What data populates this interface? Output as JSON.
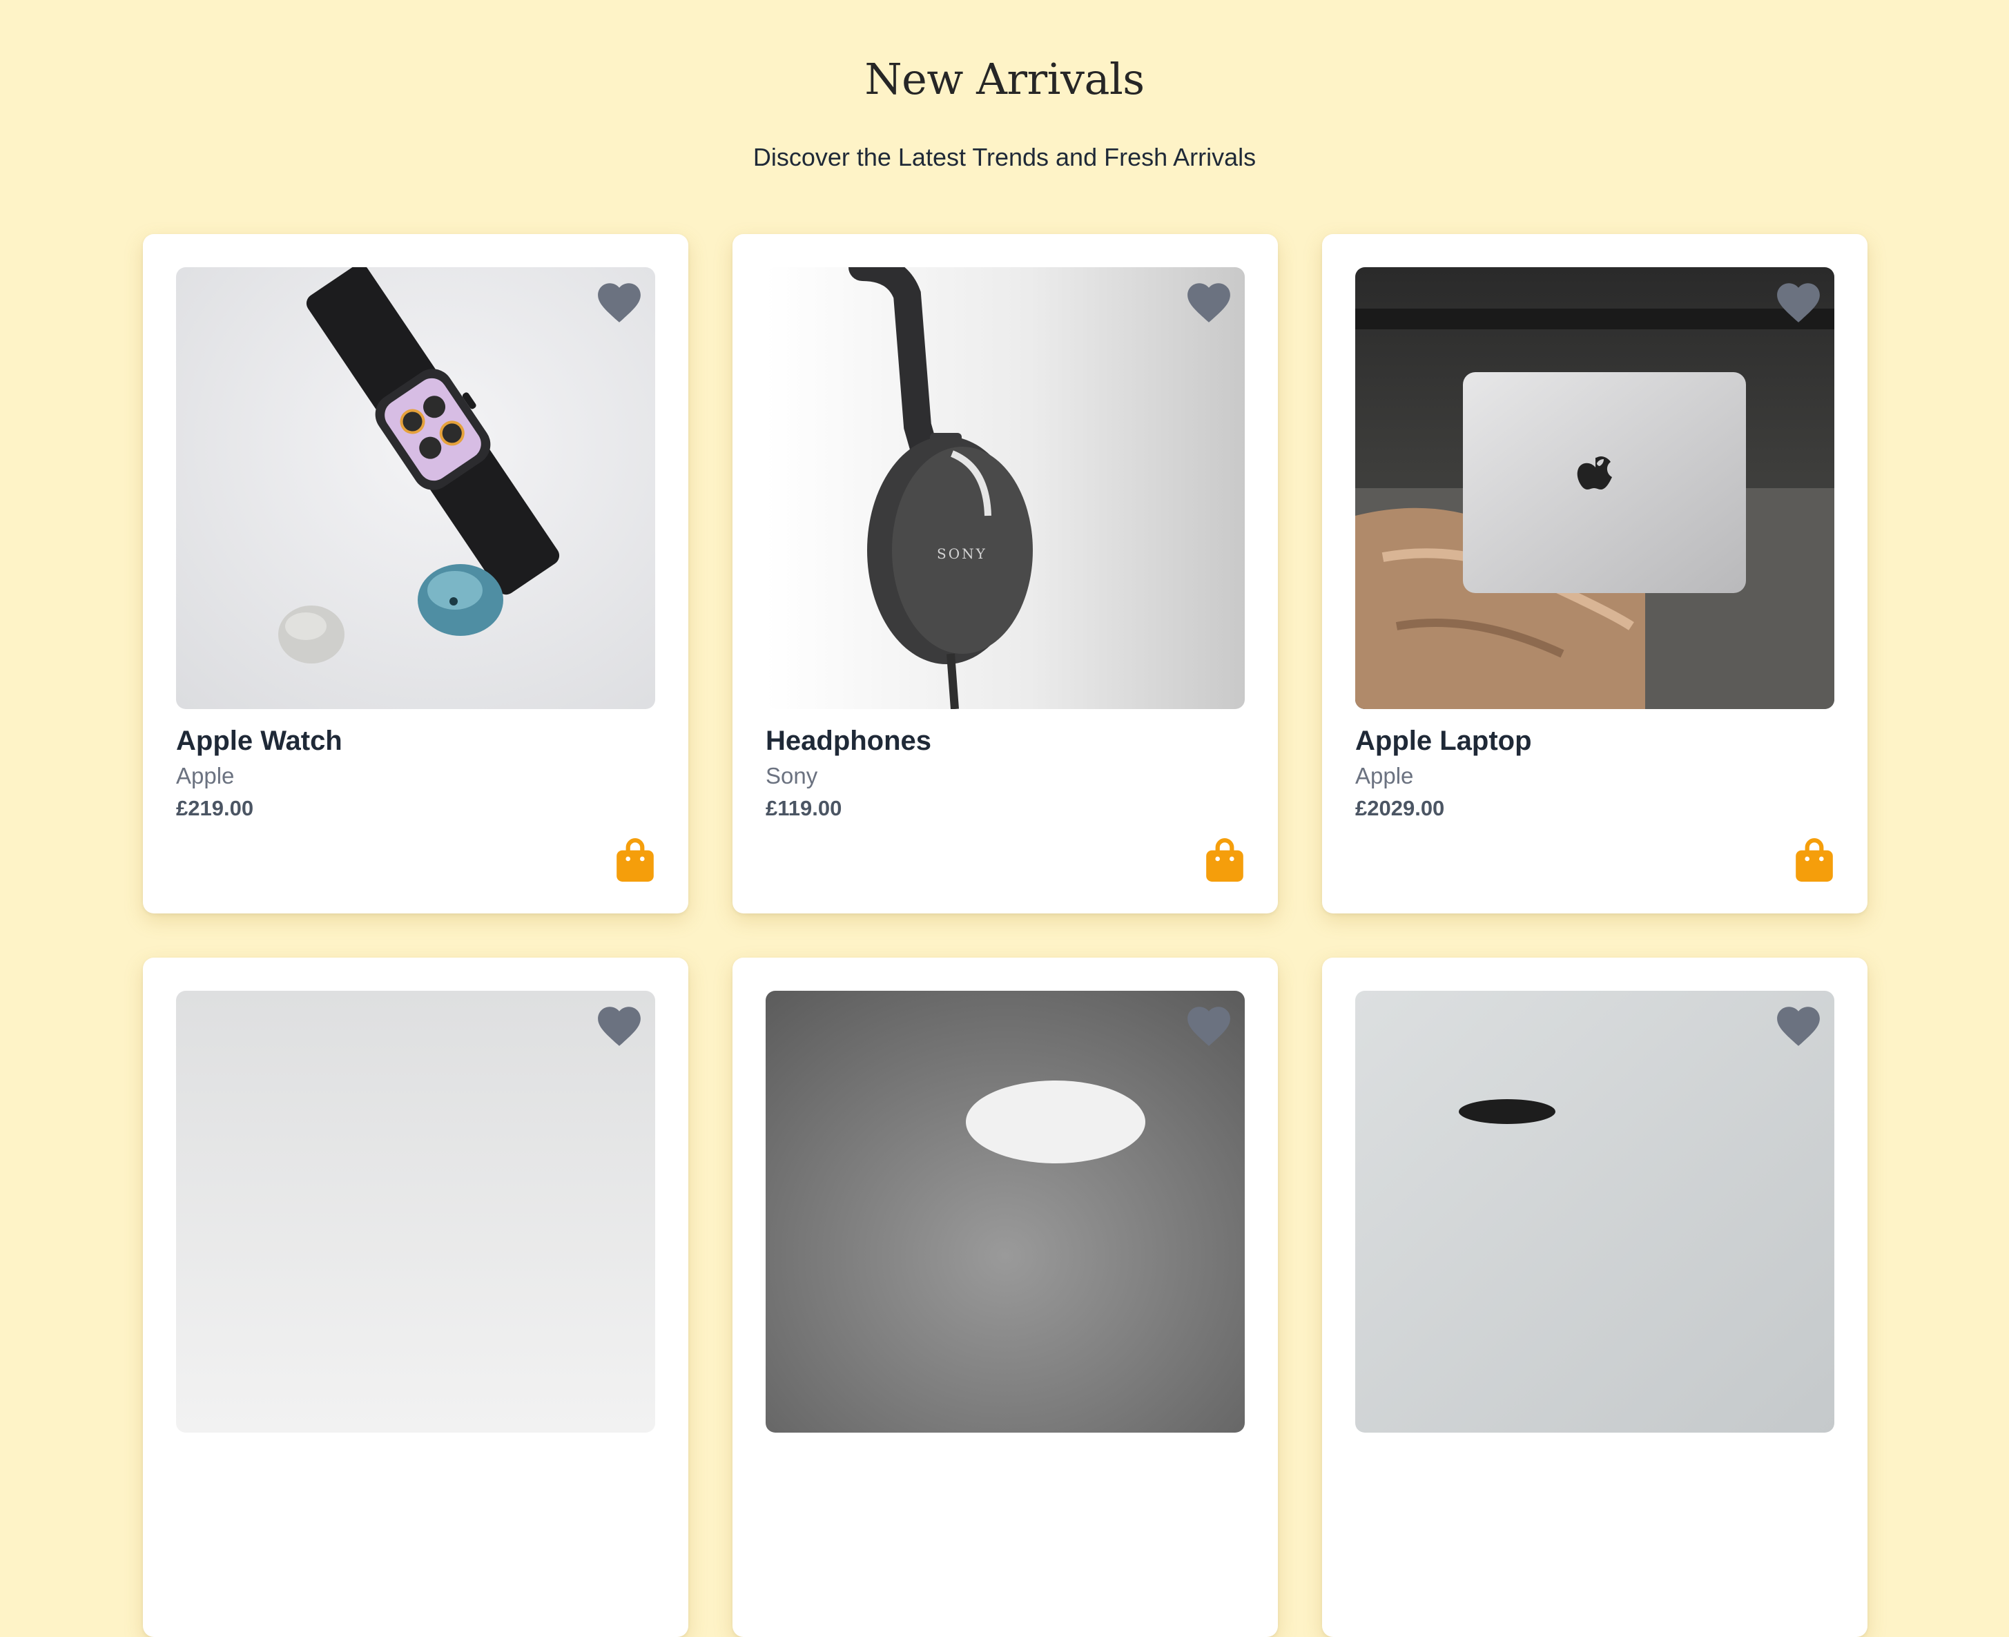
{
  "header": {
    "title": "New Arrivals",
    "subtitle": "Discover the Latest Trends and Fresh Arrivals"
  },
  "colors": {
    "page_background": "#fef3c7",
    "card_background": "#ffffff",
    "heart_icon": "#6b7280",
    "bag_icon": "#f59e0b"
  },
  "icons": {
    "favorite": "heart-icon",
    "add_to_cart": "shopping-bag-icon"
  },
  "products": [
    {
      "name": "Apple Watch",
      "brand": "Apple",
      "price": "£219.00"
    },
    {
      "name": "Headphones",
      "brand": "Sony",
      "price": "£119.00"
    },
    {
      "name": "Apple Laptop",
      "brand": "Apple",
      "price": "£2029.00"
    },
    {
      "name": "",
      "brand": "",
      "price": ""
    },
    {
      "name": "",
      "brand": "",
      "price": ""
    },
    {
      "name": "",
      "brand": "",
      "price": ""
    }
  ]
}
